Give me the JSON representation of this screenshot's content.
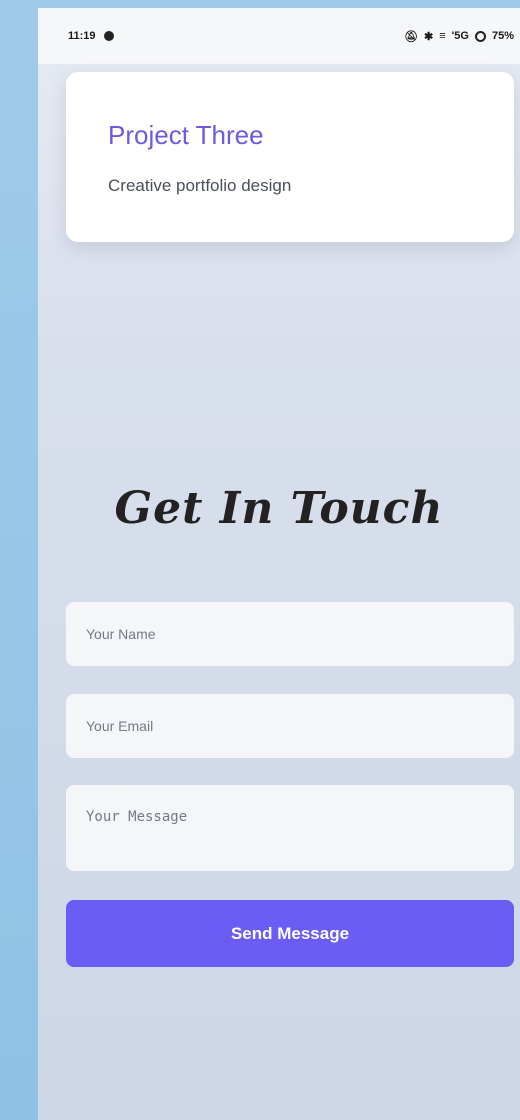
{
  "status_bar": {
    "time": "11:19",
    "signal_text": "'5G",
    "battery": "75%"
  },
  "project_card": {
    "title": "Project Three",
    "description": "Creative portfolio design"
  },
  "contact": {
    "heading": "Get In Touch",
    "name_placeholder": "Your Name",
    "email_placeholder": "Your Email",
    "message_placeholder": "Your Message",
    "submit_label": "Send Message"
  },
  "colors": {
    "accent": "#6a5cf5",
    "title": "#6a5be2"
  }
}
